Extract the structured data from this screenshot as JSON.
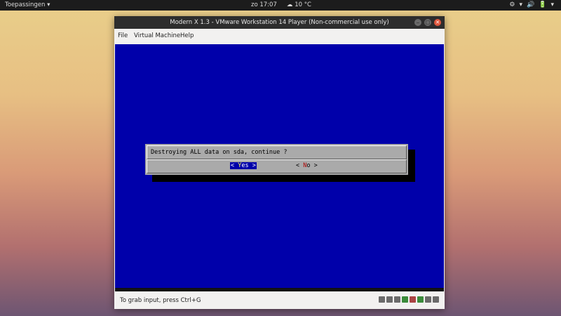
{
  "topbar": {
    "apps_label": "Toepassingen ▾",
    "clock": "zo 17:07",
    "weather": "☁ 10 °C",
    "tray": [
      "⚙",
      "▾",
      "🔊",
      "🔋",
      "▾"
    ]
  },
  "window": {
    "title": "Modern X 1.3 - VMware Workstation 14 Player (Non-commercial use only)",
    "controls": [
      "‒",
      "□",
      "✕"
    ],
    "menu": [
      "File",
      "Virtual Machine",
      "Help"
    ]
  },
  "dialog": {
    "message": "Destroying ALL data on sda, continue ?",
    "yes_open": "< ",
    "yes_hot": "Y",
    "yes_rest": "es >",
    "no_open": "< ",
    "no_hot": "N",
    "no_rest": "o  >"
  },
  "statusbar": {
    "hint": "To grab input, press Ctrl+G"
  },
  "colors": {
    "vm_background": "#0000aa",
    "dialog_background": "#aaaaaa",
    "selected_button": "#0000aa"
  }
}
